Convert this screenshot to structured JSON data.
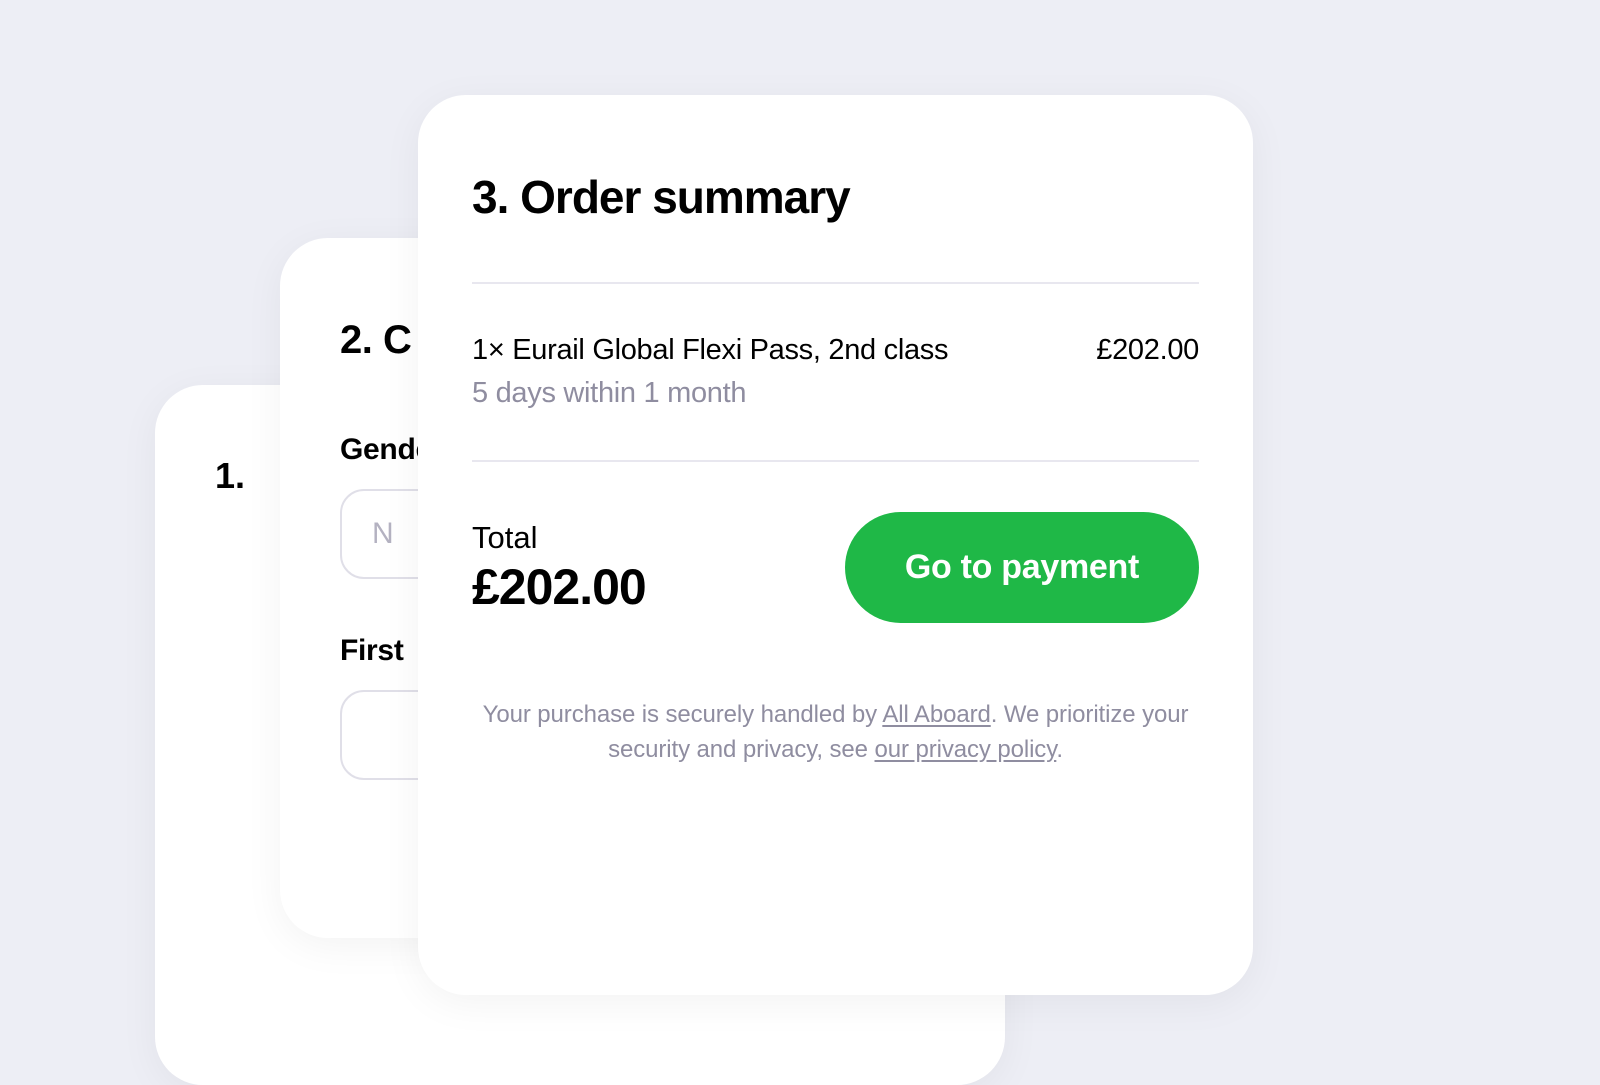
{
  "card1": {
    "step_number": "1."
  },
  "card2": {
    "step_title": "2. C",
    "gender_label": "Gender",
    "gender_placeholder": "N",
    "first_label": "First"
  },
  "card3": {
    "step_title": "3. Order summary",
    "line_item_title": "1× Eurail Global Flexi Pass, 2nd class",
    "line_item_subtitle": "5 days within 1 month",
    "line_item_price": "£202.00",
    "total_label": "Total",
    "total_amount": "£202.00",
    "payment_button_label": "Go to payment",
    "footer_prefix": "Your purchase is securely handled by ",
    "footer_link1": "All Aboard",
    "footer_mid": ". We prioritize your security and privacy, see ",
    "footer_link2": "our privacy policy",
    "footer_suffix": "."
  }
}
